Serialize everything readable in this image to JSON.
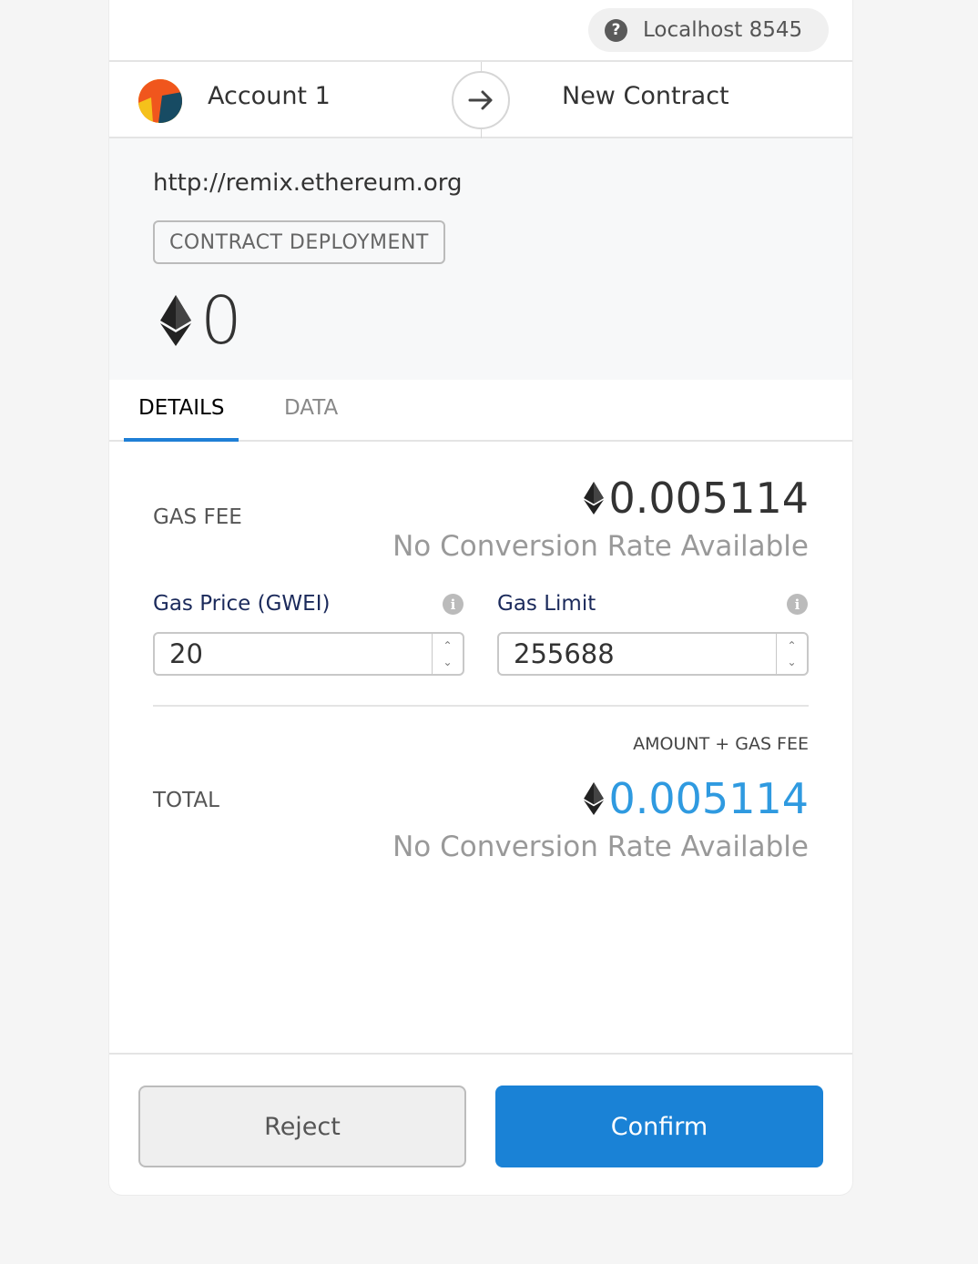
{
  "network": {
    "label": "Localhost 8545",
    "help_icon": "question-circle-icon"
  },
  "sender": {
    "name": "Account 1"
  },
  "recipient": {
    "name": "New Contract"
  },
  "summary": {
    "origin": "http://remix.ethereum.org",
    "action": "CONTRACT DEPLOYMENT",
    "amount": "0"
  },
  "tabs": {
    "details": "DETAILS",
    "data": "DATA",
    "active": "details"
  },
  "details": {
    "gas_fee_label": "GAS FEE",
    "gas_fee_value": "0.005114",
    "gas_fee_conversion": "No Conversion Rate Available",
    "gas_price_label": "Gas Price (GWEI)",
    "gas_price_value": "20",
    "gas_limit_label": "Gas Limit",
    "gas_limit_value": "255688",
    "amount_plus_gas_label": "AMOUNT + GAS FEE",
    "total_label": "TOTAL",
    "total_value": "0.005114",
    "total_conversion": "No Conversion Rate Available"
  },
  "footer": {
    "reject_label": "Reject",
    "confirm_label": "Confirm"
  },
  "colors": {
    "accent": "#1a82d6",
    "total_value": "#2f9ae0",
    "active_tab": "#1f7fd6"
  }
}
